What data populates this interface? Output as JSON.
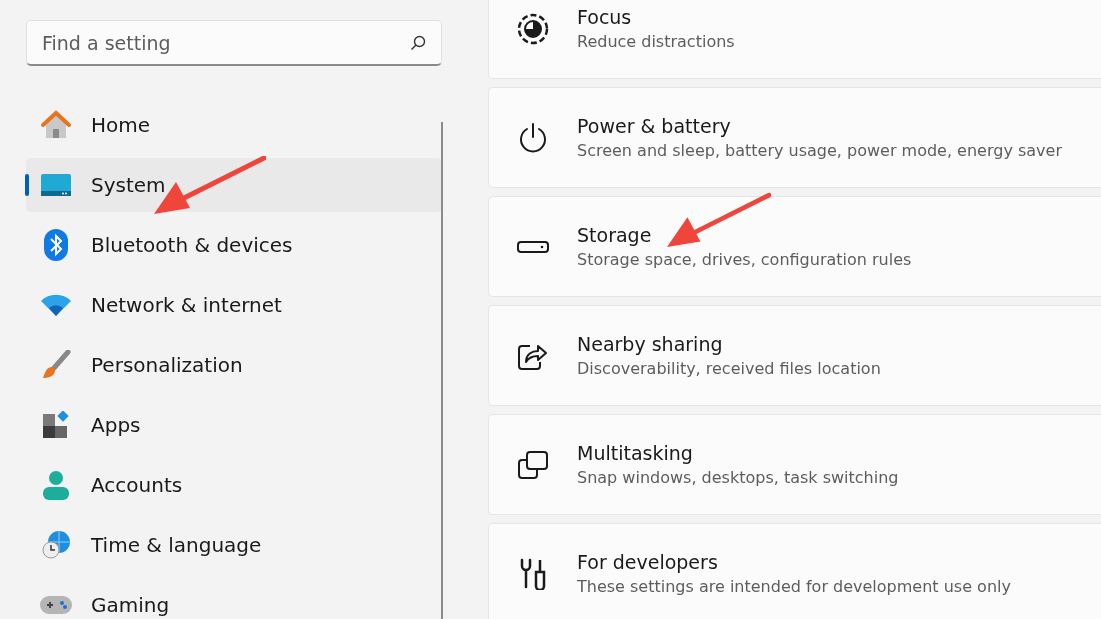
{
  "search": {
    "placeholder": "Find a setting"
  },
  "nav": [
    {
      "label": "Home",
      "selected": false,
      "arrow": false
    },
    {
      "label": "System",
      "selected": true,
      "arrow": true
    },
    {
      "label": "Bluetooth & devices",
      "selected": false,
      "arrow": false
    },
    {
      "label": "Network & internet",
      "selected": false,
      "arrow": false
    },
    {
      "label": "Personalization",
      "selected": false,
      "arrow": false
    },
    {
      "label": "Apps",
      "selected": false,
      "arrow": false
    },
    {
      "label": "Accounts",
      "selected": false,
      "arrow": false
    },
    {
      "label": "Time & language",
      "selected": false,
      "arrow": false
    },
    {
      "label": "Gaming",
      "selected": false,
      "arrow": false
    }
  ],
  "cards": [
    {
      "title": "Focus",
      "subtitle": "Reduce distractions",
      "arrow": false
    },
    {
      "title": "Power & battery",
      "subtitle": "Screen and sleep, battery usage, power mode, energy saver",
      "arrow": false
    },
    {
      "title": "Storage",
      "subtitle": "Storage space, drives, configuration rules",
      "arrow": true
    },
    {
      "title": "Nearby sharing",
      "subtitle": "Discoverability, received files location",
      "arrow": false
    },
    {
      "title": "Multitasking",
      "subtitle": "Snap windows, desktops, task switching",
      "arrow": false
    },
    {
      "title": "For developers",
      "subtitle": "These settings are intended for development use only",
      "arrow": false
    }
  ]
}
